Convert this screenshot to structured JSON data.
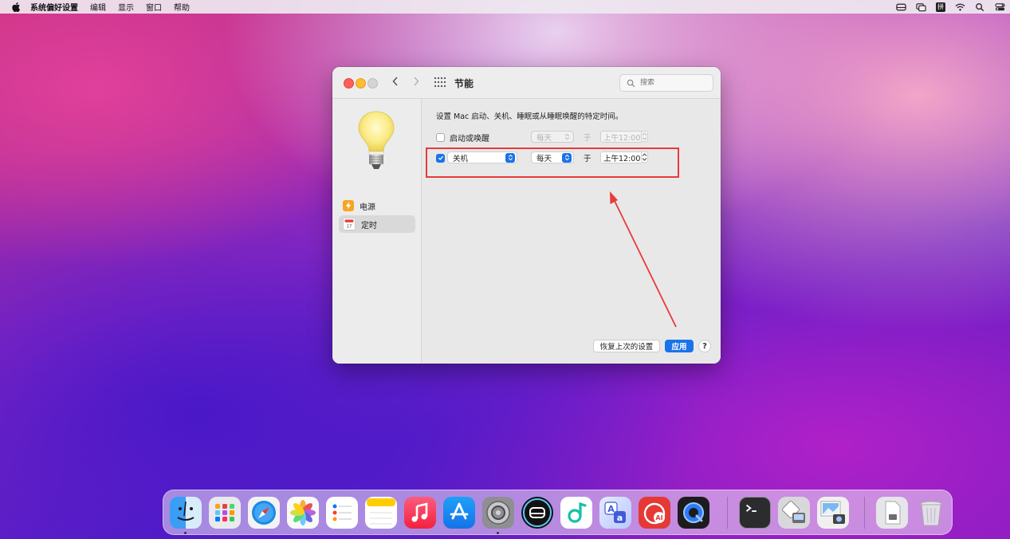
{
  "menubar": {
    "app_name": "系统偏好设置",
    "items": [
      "编辑",
      "显示",
      "窗口",
      "帮助"
    ],
    "ime_label": "拼"
  },
  "window": {
    "title": "节能",
    "search_placeholder": "搜索",
    "sidebar": {
      "items": [
        {
          "label": "电源",
          "icon": "battery-bolt-icon",
          "selected": false
        },
        {
          "label": "定时",
          "icon": "calendar-icon",
          "selected": true
        }
      ]
    },
    "content": {
      "description": "设置 Mac 启动、关机、睡眠或从睡眠唤醒的特定时间。",
      "row1": {
        "checkbox_checked": false,
        "label": "启动或唤醒",
        "frequency": "每天",
        "at_label": "于",
        "time": "上午12:00",
        "enabled": false
      },
      "row2": {
        "checkbox_checked": true,
        "action": "关机",
        "frequency": "每天",
        "at_label": "于",
        "time": "上午12:00",
        "enabled": true
      },
      "revert_button": "恢复上次的设置",
      "apply_button": "应用",
      "help_button": "?"
    }
  },
  "annotation": {
    "color": "#e83a3a"
  },
  "dock": {
    "apps": [
      {
        "name": "finder-icon",
        "running": true
      },
      {
        "name": "launchpad-icon",
        "running": false
      },
      {
        "name": "safari-icon",
        "running": false
      },
      {
        "name": "photos-icon",
        "running": false
      },
      {
        "name": "reminders-icon",
        "running": false
      },
      {
        "name": "notes-icon",
        "running": false
      },
      {
        "name": "music-icon",
        "running": false
      },
      {
        "name": "app-store-icon",
        "running": false
      },
      {
        "name": "system-preferences-icon",
        "running": true
      },
      {
        "name": "disk-utility-icon",
        "running": false
      },
      {
        "name": "music-note-app-icon",
        "running": false
      },
      {
        "name": "translate-icon",
        "running": false
      },
      {
        "name": "audio-ai-icon",
        "running": false
      },
      {
        "name": "quicktime-icon",
        "running": false
      },
      {
        "name": "terminal-icon",
        "running": false
      },
      {
        "name": "migration-assistant-icon",
        "running": false
      },
      {
        "name": "preview-icon",
        "running": false
      },
      {
        "name": "documents-folder-icon",
        "running": false
      },
      {
        "name": "trash-icon",
        "running": false
      }
    ]
  }
}
